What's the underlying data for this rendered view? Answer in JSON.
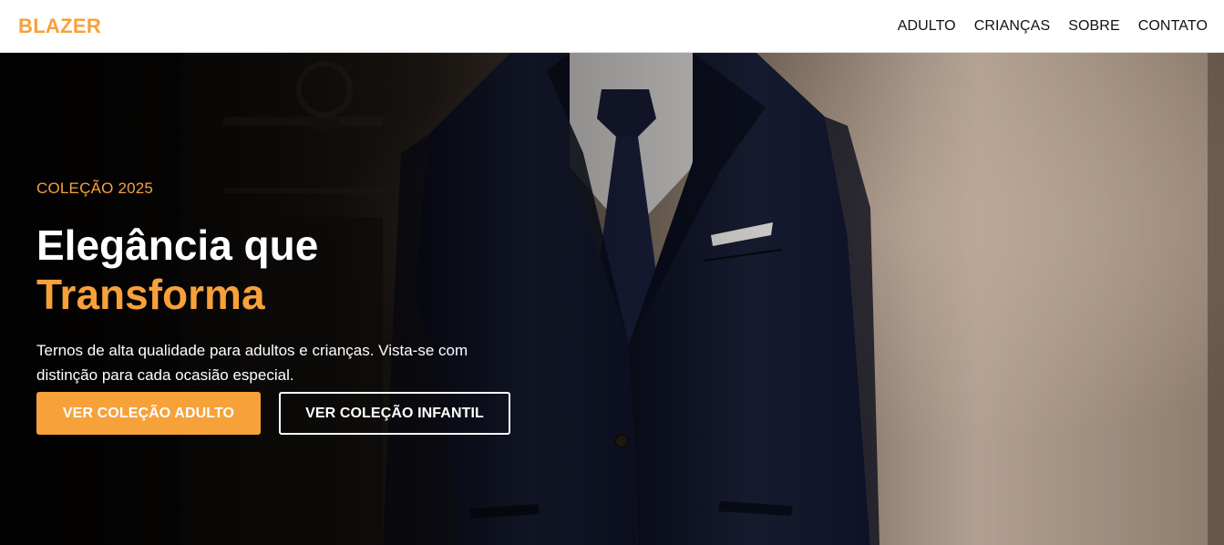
{
  "header": {
    "logo": "BLAZER",
    "nav": [
      {
        "label": "ADULTO"
      },
      {
        "label": "CRIANÇAS"
      },
      {
        "label": "SOBRE"
      },
      {
        "label": "CONTATO"
      }
    ]
  },
  "hero": {
    "eyebrow": "COLEÇÃO 2025",
    "headline_line1": "Elegância que",
    "headline_line2": "Transforma",
    "description": "Ternos de alta qualidade para adultos e crianças. Vista-se com distinção para cada ocasião especial.",
    "primary_button": "VER COLEÇÃO ADULTO",
    "secondary_button": "VER COLEÇÃO INFANTIL"
  },
  "colors": {
    "accent": "#f7a13b",
    "header_bg": "#ffffff",
    "nav_text": "#111111",
    "suit": "#151a2e"
  }
}
